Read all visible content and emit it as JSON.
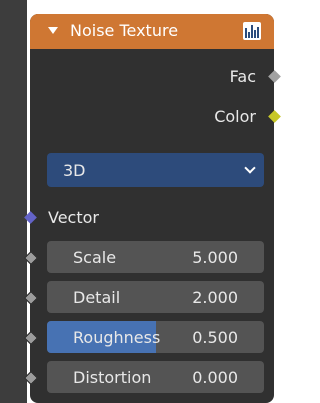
{
  "node": {
    "title": "Noise Texture",
    "header_color": "#cf7733",
    "outputs": [
      {
        "label": "Fac",
        "socket_color": "#a1a1a1"
      },
      {
        "label": "Color",
        "socket_color": "#c7c729"
      }
    ],
    "dimensions_dropdown": {
      "value": "3D"
    },
    "vector_input": {
      "label": "Vector",
      "socket_color": "#6363c7"
    },
    "fields": [
      {
        "label": "Scale",
        "value": "5.000"
      },
      {
        "label": "Detail",
        "value": "2.000"
      },
      {
        "label": "Roughness",
        "value": "0.500",
        "fill_fraction": 0.5
      },
      {
        "label": "Distortion",
        "value": "0.000"
      }
    ]
  }
}
